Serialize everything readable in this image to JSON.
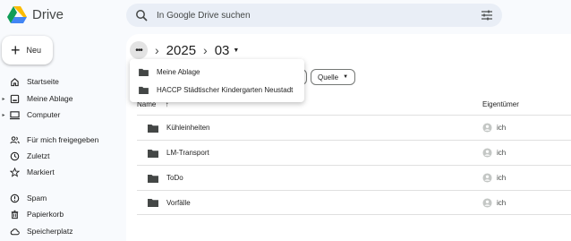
{
  "app": {
    "name": "Drive"
  },
  "search": {
    "placeholder": "In Google Drive suchen"
  },
  "new_button": {
    "label": "Neu"
  },
  "sidebar": {
    "items": [
      {
        "label": "Startseite",
        "icon": "home-icon"
      },
      {
        "label": "Meine Ablage",
        "icon": "drive-icon",
        "expandable": true
      },
      {
        "label": "Computer",
        "icon": "computer-icon",
        "expandable": true
      },
      {
        "label": "Für mich freigegeben",
        "icon": "people-icon"
      },
      {
        "label": "Zuletzt",
        "icon": "clock-icon"
      },
      {
        "label": "Markiert",
        "icon": "star-icon"
      },
      {
        "label": "Spam",
        "icon": "spam-icon"
      },
      {
        "label": "Papierkorb",
        "icon": "trash-icon"
      },
      {
        "label": "Speicherplatz",
        "icon": "cloud-icon"
      }
    ]
  },
  "breadcrumb": {
    "more": "•••",
    "items": [
      "2025",
      "03"
    ]
  },
  "breadcrumb_menu": {
    "items": [
      "Meine Ablage",
      "HACCP Städtischer Kindergarten Neustadt"
    ]
  },
  "filters": {
    "source_label": "Quelle"
  },
  "table": {
    "headers": {
      "name": "Name",
      "owner": "Eigentümer"
    },
    "rows": [
      {
        "name": "Kühleinheiten",
        "owner": "ich"
      },
      {
        "name": "LM-Transport",
        "owner": "ich"
      },
      {
        "name": "ToDo",
        "owner": "ich"
      },
      {
        "name": "Vorfälle",
        "owner": "ich"
      }
    ]
  },
  "colors": {
    "background": "#f8fafd",
    "search_bg": "#e9eef6",
    "folder": "#444746"
  }
}
